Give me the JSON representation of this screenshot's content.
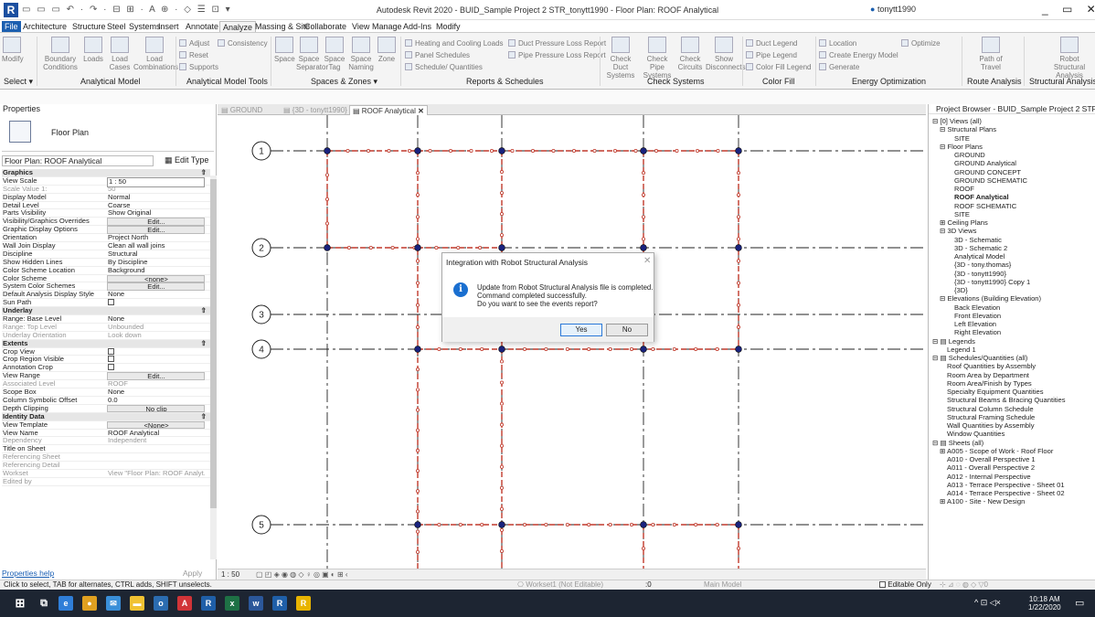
{
  "window": {
    "title": "Autodesk Revit 2020 - BUID_Sample Project 2 STR_tonytt1990 - Floor Plan: ROOF Analytical",
    "user": "tonytt1990",
    "quick_access": "▭ ▭ ▭ ↶ · ↷ · ⊟ ⊞ · A ⊕ · ◇ ☰ ⊡ ▾",
    "window_controls": "_ ▭ ✕"
  },
  "ribbon_tabs": [
    "File",
    "Architecture",
    "Structure",
    "Steel",
    "Systems",
    "Insert",
    "Annotate",
    "Analyze",
    "Massing & Site",
    "Collaborate",
    "View",
    "Manage",
    "Add-Ins",
    "Modify"
  ],
  "ribbon": {
    "modify": "Modify",
    "select": "Select ▾",
    "boundary": "Boundary Conditions",
    "loads": "Loads",
    "load_cases": "Load Cases",
    "load_comb": "Load Combinations",
    "adjust": "Adjust",
    "reset": "Reset",
    "supports": "Supports",
    "consistency": "Consistency",
    "space": "Space",
    "space_sep": "Space Separator",
    "space_tag": "Space Tag",
    "space_naming": "Space Naming",
    "zone": "Zone",
    "heating": "Heating and Cooling Loads",
    "panel_sched": "Panel Schedules",
    "sched_qty": "Schedule/ Quantities",
    "duct_press": "Duct Pressure Loss Report",
    "pipe_press": "Pipe Pressure Loss Report",
    "check_duct": "Check Duct Systems",
    "check_pipe": "Check Pipe Systems",
    "check_circ": "Check Circuits",
    "show_disc": "Show Disconnects",
    "duct_legend": "Duct Legend",
    "pipe_legend": "Pipe Legend",
    "color_fill_legend": "Color Fill Legend",
    "location": "Location",
    "create_energy": "Create Energy Model",
    "generate": "Generate",
    "optimize": "Optimize",
    "path_travel": "Path of Travel",
    "robot": "Robot Structural Analysis",
    "panels": {
      "analytical_model": "Analytical Model",
      "analytical_tools": "Analytical Model Tools",
      "spaces_zones": "Spaces & Zones ▾",
      "reports": "Reports & Schedules",
      "check_systems": "Check Systems",
      "color_fill": "Color Fill",
      "energy": "Energy Optimization",
      "route": "Route Analysis",
      "structural": "Structural Analysis"
    }
  },
  "properties": {
    "header": "Properties",
    "type_name": "Floor Plan",
    "selector": "Floor Plan: ROOF Analytical",
    "edit_type": "Edit Type",
    "help": "Properties help",
    "apply": "Apply",
    "rows": [
      {
        "kind": "cat",
        "name": "Graphics"
      },
      {
        "name": "View Scale",
        "value": "1 : 50",
        "style": "boxed"
      },
      {
        "name": "Scale Value    1:",
        "value": "50",
        "style": "gray"
      },
      {
        "name": "Display Model",
        "value": "Normal"
      },
      {
        "name": "Detail Level",
        "value": "Coarse"
      },
      {
        "name": "Parts Visibility",
        "value": "Show Original"
      },
      {
        "name": "Visibility/Graphics Overrides",
        "value": "Edit...",
        "style": "btn"
      },
      {
        "name": "Graphic Display Options",
        "value": "Edit...",
        "style": "btn"
      },
      {
        "name": "Orientation",
        "value": "Project North"
      },
      {
        "name": "Wall Join Display",
        "value": "Clean all wall joins"
      },
      {
        "name": "Discipline",
        "value": "Structural"
      },
      {
        "name": "Show Hidden Lines",
        "value": "By Discipline"
      },
      {
        "name": "Color Scheme Location",
        "value": "Background"
      },
      {
        "name": "Color Scheme",
        "value": "<none>",
        "style": "btn"
      },
      {
        "name": "System Color Schemes",
        "value": "Edit...",
        "style": "btn"
      },
      {
        "name": "Default Analysis Display Style",
        "value": "None"
      },
      {
        "name": "Sun Path",
        "value": "",
        "style": "check"
      },
      {
        "kind": "cat",
        "name": "Underlay"
      },
      {
        "name": "Range: Base Level",
        "value": "None"
      },
      {
        "name": "Range: Top Level",
        "value": "Unbounded",
        "style": "gray"
      },
      {
        "name": "Underlay Orientation",
        "value": "Look down",
        "style": "gray"
      },
      {
        "kind": "cat",
        "name": "Extents"
      },
      {
        "name": "Crop View",
        "value": "",
        "style": "check"
      },
      {
        "name": "Crop Region Visible",
        "value": "",
        "style": "check"
      },
      {
        "name": "Annotation Crop",
        "value": "",
        "style": "check"
      },
      {
        "name": "View Range",
        "value": "Edit...",
        "style": "btn"
      },
      {
        "name": "Associated Level",
        "value": "ROOF",
        "style": "gray"
      },
      {
        "name": "Scope Box",
        "value": "None"
      },
      {
        "name": "Column Symbolic Offset",
        "value": "0.0"
      },
      {
        "name": "Depth Clipping",
        "value": "No clip",
        "style": "btn"
      },
      {
        "kind": "cat",
        "name": "Identity Data"
      },
      {
        "name": "View Template",
        "value": "<None>",
        "style": "btn"
      },
      {
        "name": "View Name",
        "value": "ROOF Analytical"
      },
      {
        "name": "Dependency",
        "value": "Independent",
        "style": "gray"
      },
      {
        "name": "Title on Sheet",
        "value": ""
      },
      {
        "name": "Referencing Sheet",
        "value": "",
        "style": "gray"
      },
      {
        "name": "Referencing Detail",
        "value": "",
        "style": "gray"
      },
      {
        "name": "Workset",
        "value": "View \"Floor Plan: ROOF Analyt...",
        "style": "gray"
      },
      {
        "name": "Edited by",
        "value": "",
        "style": "gray"
      }
    ]
  },
  "view_tabs": [
    {
      "label": "GROUND",
      "active": false
    },
    {
      "label": "{3D - tonytt1990}",
      "active": false
    },
    {
      "label": "ROOF Analytical",
      "active": true
    }
  ],
  "grids": [
    "1",
    "2",
    "3",
    "4",
    "5"
  ],
  "view_scale": "1 : 50",
  "view_icons": "▢ ◰ ◈ ◉ ◍ ◇ ♀ ◎ ▣ ◐ ⊞ ‹",
  "dialog": {
    "title": "Integration with Robot Structural Analysis",
    "close": "✕",
    "line1": "Update from Robot Structural Analysis file is completed.",
    "line2": "Command completed successfully.",
    "line3": "Do you want to see the events report?",
    "yes": "Yes",
    "no": "No"
  },
  "browser": {
    "header": "Project Browser - BUID_Sample Project 2 STR_tony...",
    "nodes": [
      {
        "t": "⊟ [0] Views (all)",
        "x": 4
      },
      {
        "t": "⊟ Structural Plans",
        "x": 12
      },
      {
        "t": "SITE",
        "x": 28
      },
      {
        "t": "⊟ Floor Plans",
        "x": 12
      },
      {
        "t": "GROUND",
        "x": 28
      },
      {
        "t": "GROUND Analytical",
        "x": 28
      },
      {
        "t": "GROUND CONCEPT",
        "x": 28
      },
      {
        "t": "GROUND SCHEMATIC",
        "x": 28
      },
      {
        "t": "ROOF",
        "x": 28
      },
      {
        "t": "ROOF Analytical",
        "x": 28,
        "bold": true
      },
      {
        "t": "ROOF SCHEMATIC",
        "x": 28
      },
      {
        "t": "SITE",
        "x": 28
      },
      {
        "t": "⊞ Ceiling Plans",
        "x": 12
      },
      {
        "t": "⊟ 3D Views",
        "x": 12
      },
      {
        "t": "3D - Schematic",
        "x": 28
      },
      {
        "t": "3D - Schematic 2",
        "x": 28
      },
      {
        "t": "Analytical Model",
        "x": 28
      },
      {
        "t": "{3D - tony.thomas}",
        "x": 28
      },
      {
        "t": "{3D - tonytt1990}",
        "x": 28
      },
      {
        "t": "{3D - tonytt1990} Copy 1",
        "x": 28
      },
      {
        "t": "{3D}",
        "x": 28
      },
      {
        "t": "⊟ Elevations (Building Elevation)",
        "x": 12
      },
      {
        "t": "Back Elevation",
        "x": 28
      },
      {
        "t": "Front Elevation",
        "x": 28
      },
      {
        "t": "Left Elevation",
        "x": 28
      },
      {
        "t": "Right Elevation",
        "x": 28
      },
      {
        "t": "⊟ ▤ Legends",
        "x": 4
      },
      {
        "t": "Legend 1",
        "x": 20
      },
      {
        "t": "⊟ ▤ Schedules/Quantities (all)",
        "x": 4
      },
      {
        "t": "Roof Quantities by Assembly",
        "x": 20
      },
      {
        "t": "Room Area by Department",
        "x": 20
      },
      {
        "t": "Room Area/Finish by Types",
        "x": 20
      },
      {
        "t": "Specialty Equipment Quantities",
        "x": 20
      },
      {
        "t": "Structural Beams & Bracing Quantities",
        "x": 20
      },
      {
        "t": "Structural Column Schedule",
        "x": 20
      },
      {
        "t": "Structural Framing Schedule",
        "x": 20
      },
      {
        "t": "Wall Quantities by Assembly",
        "x": 20
      },
      {
        "t": "Window Quantities",
        "x": 20
      },
      {
        "t": "⊟ ▤ Sheets (all)",
        "x": 4
      },
      {
        "t": "⊞ A005 - Scope of Work - Roof Floor",
        "x": 12
      },
      {
        "t": "A010 - Overall Perspective 1",
        "x": 20
      },
      {
        "t": "A011 - Overall Perspective 2",
        "x": 20
      },
      {
        "t": "A012 - Internal Perspective",
        "x": 20
      },
      {
        "t": "A013 - Terrace Perspective - Sheet 01",
        "x": 20
      },
      {
        "t": "A014 - Terrace Perspective - Sheet 02",
        "x": 20
      },
      {
        "t": "⊞ A100 - Site - New Design",
        "x": 12
      }
    ]
  },
  "status": {
    "hint": "Click to select, TAB for alternates, CTRL adds, SHIFT unselects.",
    "workset": "Workset1 (Not Editable)",
    "zero": ":0",
    "model": "Main Model",
    "editable_only": "Editable Only"
  },
  "taskbar": {
    "time": "10:18 AM",
    "date": "1/22/2020"
  },
  "colors": {
    "file_tab": "#1b5fb0",
    "beam": "#c0392b",
    "node": "#1a237e",
    "taskbar": "#1d2532"
  }
}
